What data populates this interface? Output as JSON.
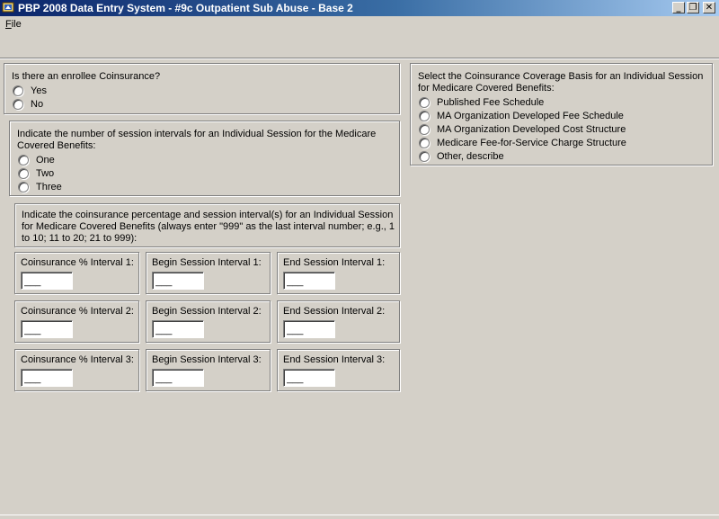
{
  "window": {
    "title": "PBP 2008 Data Entry System - #9c Outpatient Sub Abuse - Base 2",
    "minimize_glyph": "_",
    "restore_glyph": "❐",
    "close_glyph": "✕",
    "title_color": "#0a246a"
  },
  "menu": {
    "file_accel": "F",
    "file_rest": "ile"
  },
  "coinsurance_question": {
    "label": "Is there an enrollee Coinsurance?",
    "options": [
      "Yes",
      "No"
    ]
  },
  "session_intervals": {
    "label": "Indicate the number of session intervals for an Individual Session for the Medicare Covered Benefits:",
    "options": [
      "One",
      "Two",
      "Three"
    ]
  },
  "percentage_instructions": {
    "label": "Indicate the coinsurance percentage and session interval(s) for an Individual Session for Medicare Covered Benefits (always enter \"999\" as the last interval number; e.g., 1 to 10; 11 to 20; 21 to 999):"
  },
  "intervals": [
    {
      "coinsurance_label": "Coinsurance % Interval 1:",
      "begin_label": "Begin Session Interval 1:",
      "end_label": "End Session Interval 1:",
      "coinsurance_value": "___",
      "begin_value": "___",
      "end_value": "___"
    },
    {
      "coinsurance_label": "Coinsurance % Interval 2:",
      "begin_label": "Begin Session Interval 2:",
      "end_label": "End Session Interval 2:",
      "coinsurance_value": "___",
      "begin_value": "___",
      "end_value": "___"
    },
    {
      "coinsurance_label": "Coinsurance % Interval 3:",
      "begin_label": "Begin Session Interval 3:",
      "end_label": "End Session Interval 3:",
      "coinsurance_value": "___",
      "begin_value": "___",
      "end_value": "___"
    }
  ],
  "coverage_basis": {
    "label": "Select the Coinsurance Coverage Basis for an Individual Session for Medicare Covered Benefits:",
    "options": [
      "Published Fee Schedule",
      "MA Organization Developed Fee Schedule",
      "MA Organization Developed Cost Structure",
      "Medicare Fee-for-Service Charge Structure",
      "Other, describe"
    ]
  }
}
